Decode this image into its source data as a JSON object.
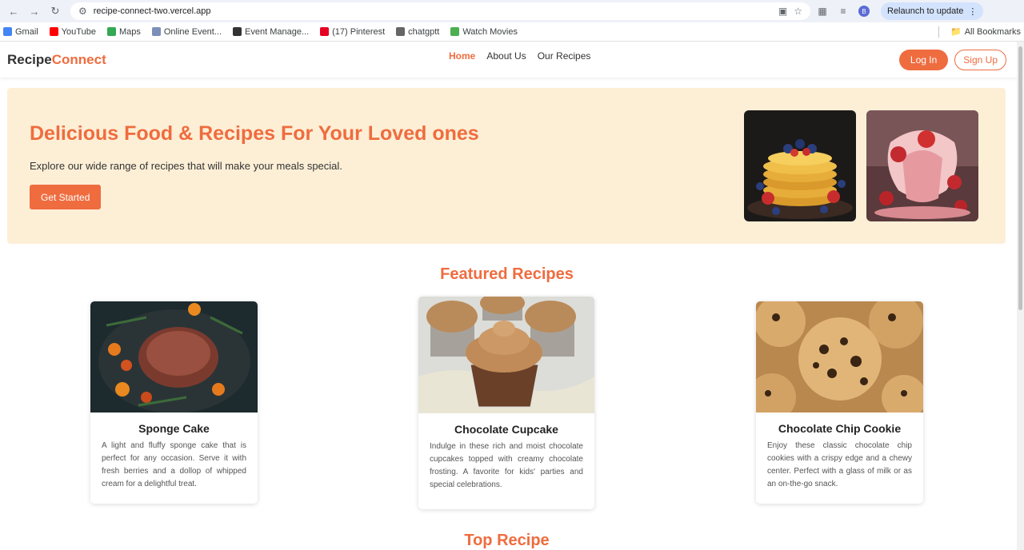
{
  "browser": {
    "url": "recipe-connect-two.vercel.app",
    "avatar_letter": "B",
    "relaunch_label": "Relaunch to update",
    "bookmarks": [
      {
        "label": "Gmail",
        "color": "#4285f4"
      },
      {
        "label": "YouTube",
        "color": "#ff0000"
      },
      {
        "label": "Maps",
        "color": "#34a853"
      },
      {
        "label": "Online Event...",
        "color": "#7b8fb8"
      },
      {
        "label": "Event Manage...",
        "color": "#333333"
      },
      {
        "label": "(17) Pinterest",
        "color": "#e60023"
      },
      {
        "label": "chatgptt",
        "color": "#666666"
      },
      {
        "label": "Watch Movies",
        "color": "#4caf50"
      }
    ],
    "all_bookmarks": "All Bookmarks"
  },
  "site": {
    "logo_main": "Recipe",
    "logo_accent": "Connect",
    "nav": [
      "Home",
      "About Us",
      "Our Recipes"
    ],
    "login": "Log In",
    "signup": "Sign Up"
  },
  "hero": {
    "title": "Delicious Food & Recipes For Your Loved ones",
    "subtitle": "Explore our wide range of recipes that will make your meals special.",
    "cta": "Get Started"
  },
  "featured": {
    "title": "Featured Recipes",
    "cards": [
      {
        "title": "Sponge Cake",
        "text": "A light and fluffy sponge cake that is perfect for any occasion. Serve it with fresh berries and a dollop of whipped cream for a delightful treat."
      },
      {
        "title": "Chocolate Cupcake",
        "text": "Indulge in these rich and moist chocolate cupcakes topped with creamy chocolate frosting. A favorite for kids' parties and special celebrations."
      },
      {
        "title": "Chocolate Chip Cookie",
        "text": "Enjoy these classic chocolate chip cookies with a crispy edge and a chewy center. Perfect with a glass of milk or as an on-the-go snack."
      }
    ]
  },
  "top": {
    "title": "Top Recipe"
  },
  "colors": {
    "accent": "#ef6c3f",
    "hero_bg": "#fdefd6"
  }
}
